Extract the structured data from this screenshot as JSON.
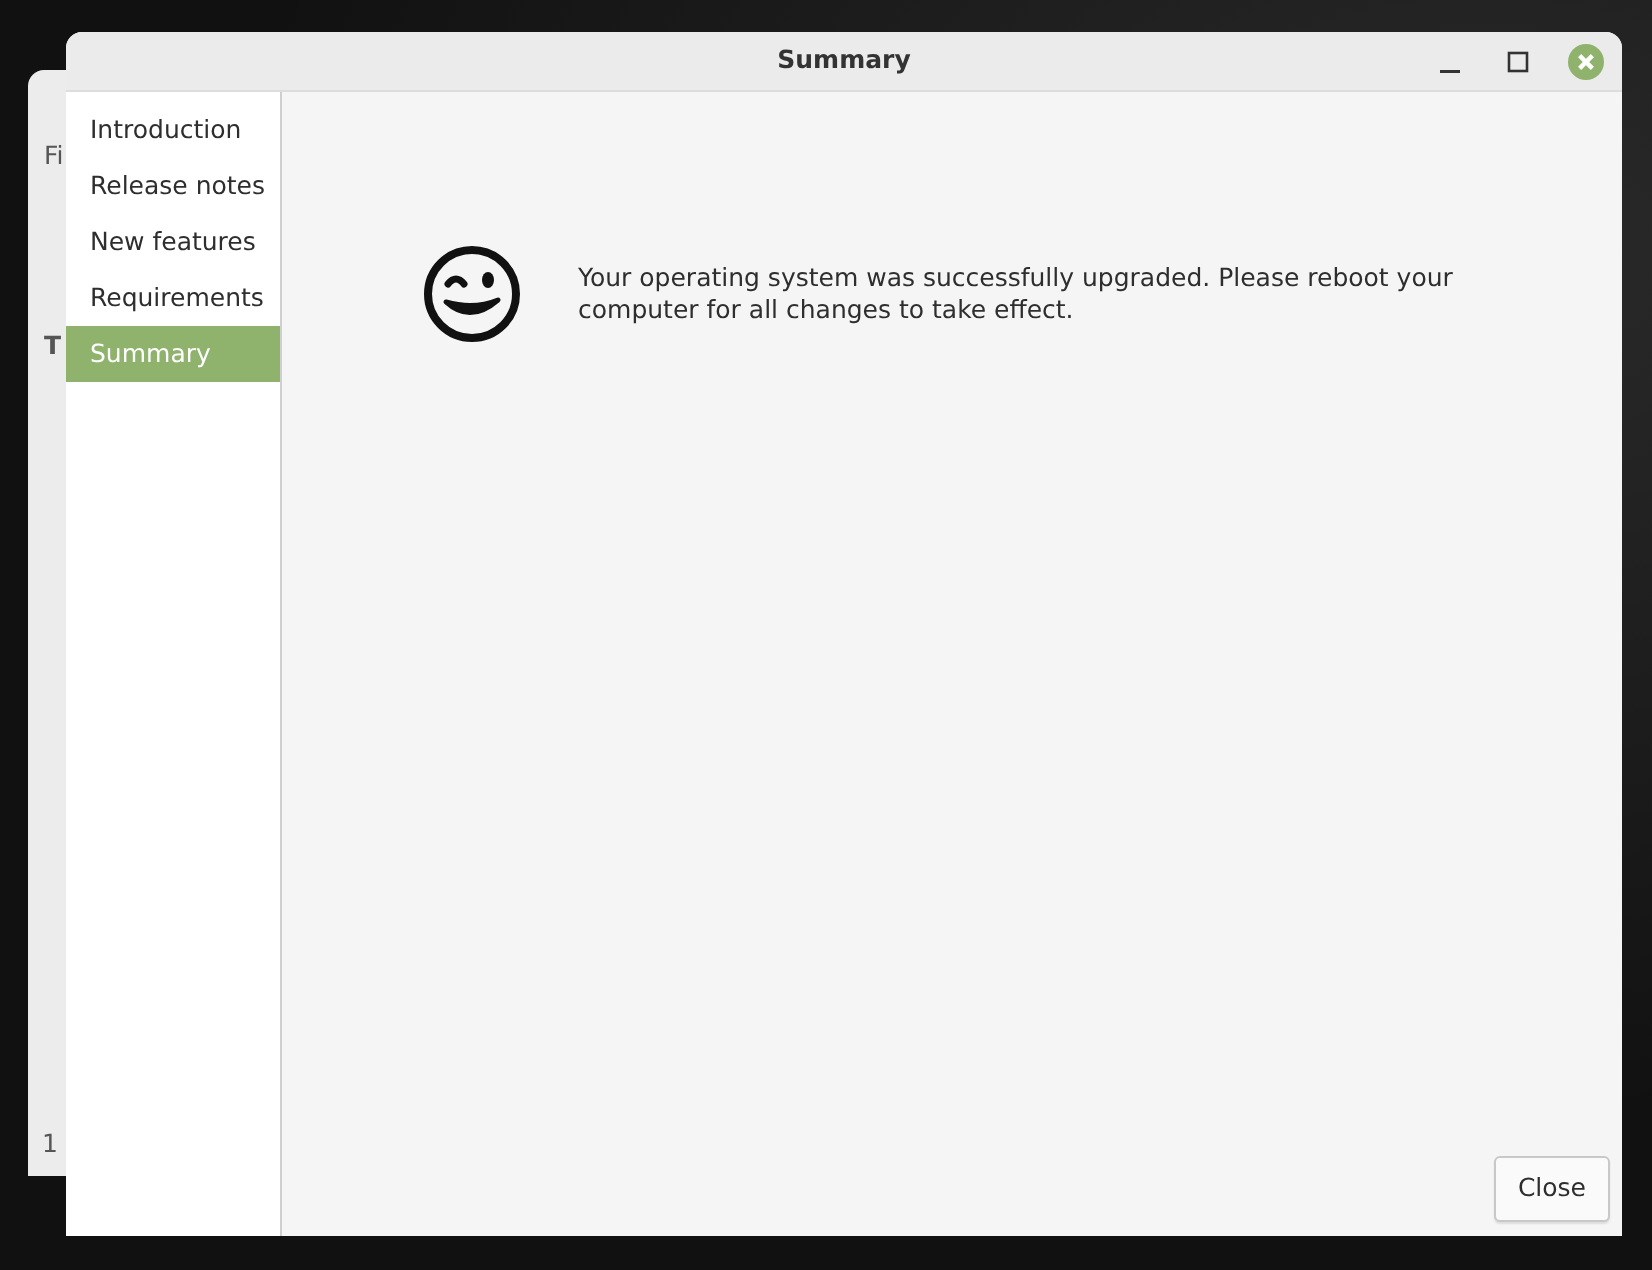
{
  "background_window": {
    "texts": [
      "Fi",
      "T",
      "1"
    ]
  },
  "window": {
    "title": "Summary"
  },
  "sidebar": {
    "items": [
      {
        "label": "Introduction",
        "selected": false
      },
      {
        "label": "Release notes",
        "selected": false
      },
      {
        "label": "New features",
        "selected": false
      },
      {
        "label": "Requirements",
        "selected": false
      },
      {
        "label": "Summary",
        "selected": true
      }
    ]
  },
  "message": "Your operating system was successfully upgraded. Please reboot your computer for all changes to take effect.",
  "buttons": [
    "Close"
  ]
}
